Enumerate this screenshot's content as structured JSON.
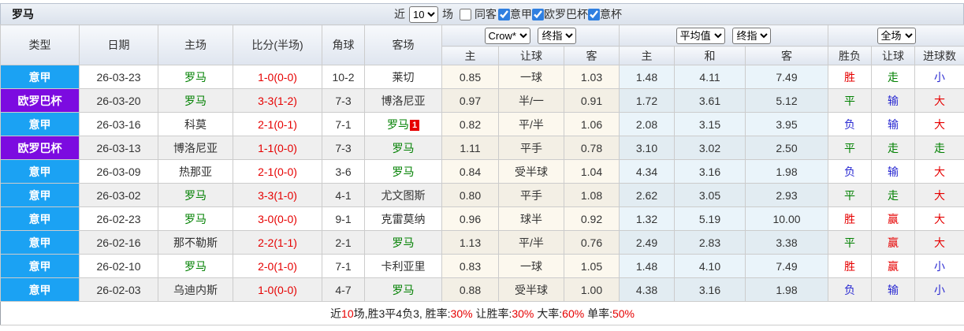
{
  "colors": {
    "serie_a_badge": "#1ba2f3",
    "europa_badge": "#7c0be0",
    "roma_green": "#008000",
    "score_red": "#e60000",
    "result_red": "#e60000",
    "result_green": "#008000",
    "result_blue": "#2a2ad2",
    "away_badge_red": "#e60000"
  },
  "header": {
    "team": "罗马",
    "toolbar": {
      "recent_label": "近",
      "matches_count": "10",
      "matches_label": "场",
      "same_venue": {
        "label": "同客",
        "checked": false
      },
      "filters": [
        {
          "label": "意甲",
          "checked": true
        },
        {
          "label": "欧罗巴杯",
          "checked": true
        },
        {
          "label": "意杯",
          "checked": true
        }
      ]
    }
  },
  "table": {
    "columns": [
      "类型",
      "日期",
      "主场",
      "比分(半场)",
      "角球",
      "客场"
    ],
    "selects": {
      "asian_company": "Crow*",
      "asian_type": "终指",
      "euro_company": "平均值",
      "euro_type": "终指",
      "result_scope": "全场"
    },
    "sub_headers": [
      "主",
      "让球",
      "客",
      "主",
      "和",
      "客",
      "胜负",
      "让球",
      "进球数"
    ],
    "rows": [
      {
        "league": "意甲",
        "league_type": "serie_a",
        "date": "26-03-23",
        "home": "罗马",
        "home_roma": true,
        "score": "1-0(0-0)",
        "corner": "10-2",
        "away": "莱切",
        "away_roma": false,
        "away_badge": "",
        "asian": [
          "0.85",
          "一球",
          "1.03"
        ],
        "euro": [
          "1.48",
          "4.11",
          "7.49"
        ],
        "results": [
          {
            "t": "胜",
            "c": "red"
          },
          {
            "t": "走",
            "c": "green"
          },
          {
            "t": "小",
            "c": "blue"
          }
        ]
      },
      {
        "league": "欧罗巴杯",
        "league_type": "europa",
        "date": "26-03-20",
        "home": "罗马",
        "home_roma": true,
        "score": "3-3(1-2)",
        "corner": "7-3",
        "away": "博洛尼亚",
        "away_roma": false,
        "away_badge": "",
        "asian": [
          "0.97",
          "半/一",
          "0.91"
        ],
        "euro": [
          "1.72",
          "3.61",
          "5.12"
        ],
        "results": [
          {
            "t": "平",
            "c": "green"
          },
          {
            "t": "输",
            "c": "blue"
          },
          {
            "t": "大",
            "c": "red"
          }
        ]
      },
      {
        "league": "意甲",
        "league_type": "serie_a",
        "date": "26-03-16",
        "home": "科莫",
        "home_roma": false,
        "score": "2-1(0-1)",
        "corner": "7-1",
        "away": "罗马",
        "away_roma": true,
        "away_badge": "1",
        "asian": [
          "0.82",
          "平/半",
          "1.06"
        ],
        "euro": [
          "2.08",
          "3.15",
          "3.95"
        ],
        "results": [
          {
            "t": "负",
            "c": "blue"
          },
          {
            "t": "输",
            "c": "blue"
          },
          {
            "t": "大",
            "c": "red"
          }
        ]
      },
      {
        "league": "欧罗巴杯",
        "league_type": "europa",
        "date": "26-03-13",
        "home": "博洛尼亚",
        "home_roma": false,
        "score": "1-1(0-0)",
        "corner": "7-3",
        "away": "罗马",
        "away_roma": true,
        "away_badge": "",
        "asian": [
          "1.11",
          "平手",
          "0.78"
        ],
        "euro": [
          "3.10",
          "3.02",
          "2.50"
        ],
        "results": [
          {
            "t": "平",
            "c": "green"
          },
          {
            "t": "走",
            "c": "green"
          },
          {
            "t": "走",
            "c": "green"
          }
        ]
      },
      {
        "league": "意甲",
        "league_type": "serie_a",
        "date": "26-03-09",
        "home": "热那亚",
        "home_roma": false,
        "score": "2-1(0-0)",
        "corner": "3-6",
        "away": "罗马",
        "away_roma": true,
        "away_badge": "",
        "asian": [
          "0.84",
          "受半球",
          "1.04"
        ],
        "euro": [
          "4.34",
          "3.16",
          "1.98"
        ],
        "results": [
          {
            "t": "负",
            "c": "blue"
          },
          {
            "t": "输",
            "c": "blue"
          },
          {
            "t": "大",
            "c": "red"
          }
        ]
      },
      {
        "league": "意甲",
        "league_type": "serie_a",
        "date": "26-03-02",
        "home": "罗马",
        "home_roma": true,
        "score": "3-3(1-0)",
        "corner": "4-1",
        "away": "尤文图斯",
        "away_roma": false,
        "away_badge": "",
        "asian": [
          "0.80",
          "平手",
          "1.08"
        ],
        "euro": [
          "2.62",
          "3.05",
          "2.93"
        ],
        "results": [
          {
            "t": "平",
            "c": "green"
          },
          {
            "t": "走",
            "c": "green"
          },
          {
            "t": "大",
            "c": "red"
          }
        ]
      },
      {
        "league": "意甲",
        "league_type": "serie_a",
        "date": "26-02-23",
        "home": "罗马",
        "home_roma": true,
        "score": "3-0(0-0)",
        "corner": "9-1",
        "away": "克雷莫纳",
        "away_roma": false,
        "away_badge": "",
        "asian": [
          "0.96",
          "球半",
          "0.92"
        ],
        "euro": [
          "1.32",
          "5.19",
          "10.00"
        ],
        "results": [
          {
            "t": "胜",
            "c": "red"
          },
          {
            "t": "赢",
            "c": "red"
          },
          {
            "t": "大",
            "c": "red"
          }
        ]
      },
      {
        "league": "意甲",
        "league_type": "serie_a",
        "date": "26-02-16",
        "home": "那不勒斯",
        "home_roma": false,
        "score": "2-2(1-1)",
        "corner": "2-1",
        "away": "罗马",
        "away_roma": true,
        "away_badge": "",
        "asian": [
          "1.13",
          "平/半",
          "0.76"
        ],
        "euro": [
          "2.49",
          "2.83",
          "3.38"
        ],
        "results": [
          {
            "t": "平",
            "c": "green"
          },
          {
            "t": "赢",
            "c": "red"
          },
          {
            "t": "大",
            "c": "red"
          }
        ]
      },
      {
        "league": "意甲",
        "league_type": "serie_a",
        "date": "26-02-10",
        "home": "罗马",
        "home_roma": true,
        "score": "2-0(1-0)",
        "corner": "7-1",
        "away": "卡利亚里",
        "away_roma": false,
        "away_badge": "",
        "asian": [
          "0.83",
          "一球",
          "1.05"
        ],
        "euro": [
          "1.48",
          "4.10",
          "7.49"
        ],
        "results": [
          {
            "t": "胜",
            "c": "red"
          },
          {
            "t": "赢",
            "c": "red"
          },
          {
            "t": "小",
            "c": "blue"
          }
        ]
      },
      {
        "league": "意甲",
        "league_type": "serie_a",
        "date": "26-02-03",
        "home": "乌迪内斯",
        "home_roma": false,
        "score": "1-0(0-0)",
        "corner": "4-7",
        "away": "罗马",
        "away_roma": true,
        "away_badge": "",
        "asian": [
          "0.88",
          "受半球",
          "1.00"
        ],
        "euro": [
          "4.38",
          "3.16",
          "1.98"
        ],
        "results": [
          {
            "t": "负",
            "c": "blue"
          },
          {
            "t": "输",
            "c": "blue"
          },
          {
            "t": "小",
            "c": "blue"
          }
        ]
      }
    ]
  },
  "footer": {
    "segments": [
      {
        "text": "近",
        "color": "black"
      },
      {
        "text": "10",
        "color": "red"
      },
      {
        "text": "场,胜3平4负3, 胜率:",
        "color": "black"
      },
      {
        "text": "30%",
        "color": "red"
      },
      {
        "text": " 让胜率:",
        "color": "black"
      },
      {
        "text": "30%",
        "color": "red"
      },
      {
        "text": " 大率:",
        "color": "black"
      },
      {
        "text": "60%",
        "color": "red"
      },
      {
        "text": " 单率:",
        "color": "black"
      },
      {
        "text": "50%",
        "color": "red"
      }
    ]
  }
}
